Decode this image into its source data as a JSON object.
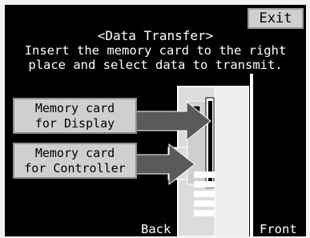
{
  "header": {
    "exit_label": "Exit",
    "title": "<Data Transfer>"
  },
  "instructions": {
    "line1": "Insert the memory card to the right",
    "line2": "place and select data to transmit."
  },
  "buttons": {
    "display_line1": "Memory card",
    "display_line2": "for Display",
    "controller_line1": "Memory card",
    "controller_line2": "for Controller"
  },
  "labels": {
    "back": "Back",
    "front": "Front"
  },
  "colors": {
    "screen_background": "#000000",
    "button_face": "#cfcfcf",
    "arrow": "#5a5a5a",
    "device_body": "#dcdcdc",
    "text": "#ffffff"
  },
  "icons": [
    "arrow-right-icon",
    "controller-device-icon",
    "memory-card-slot-icon"
  ]
}
